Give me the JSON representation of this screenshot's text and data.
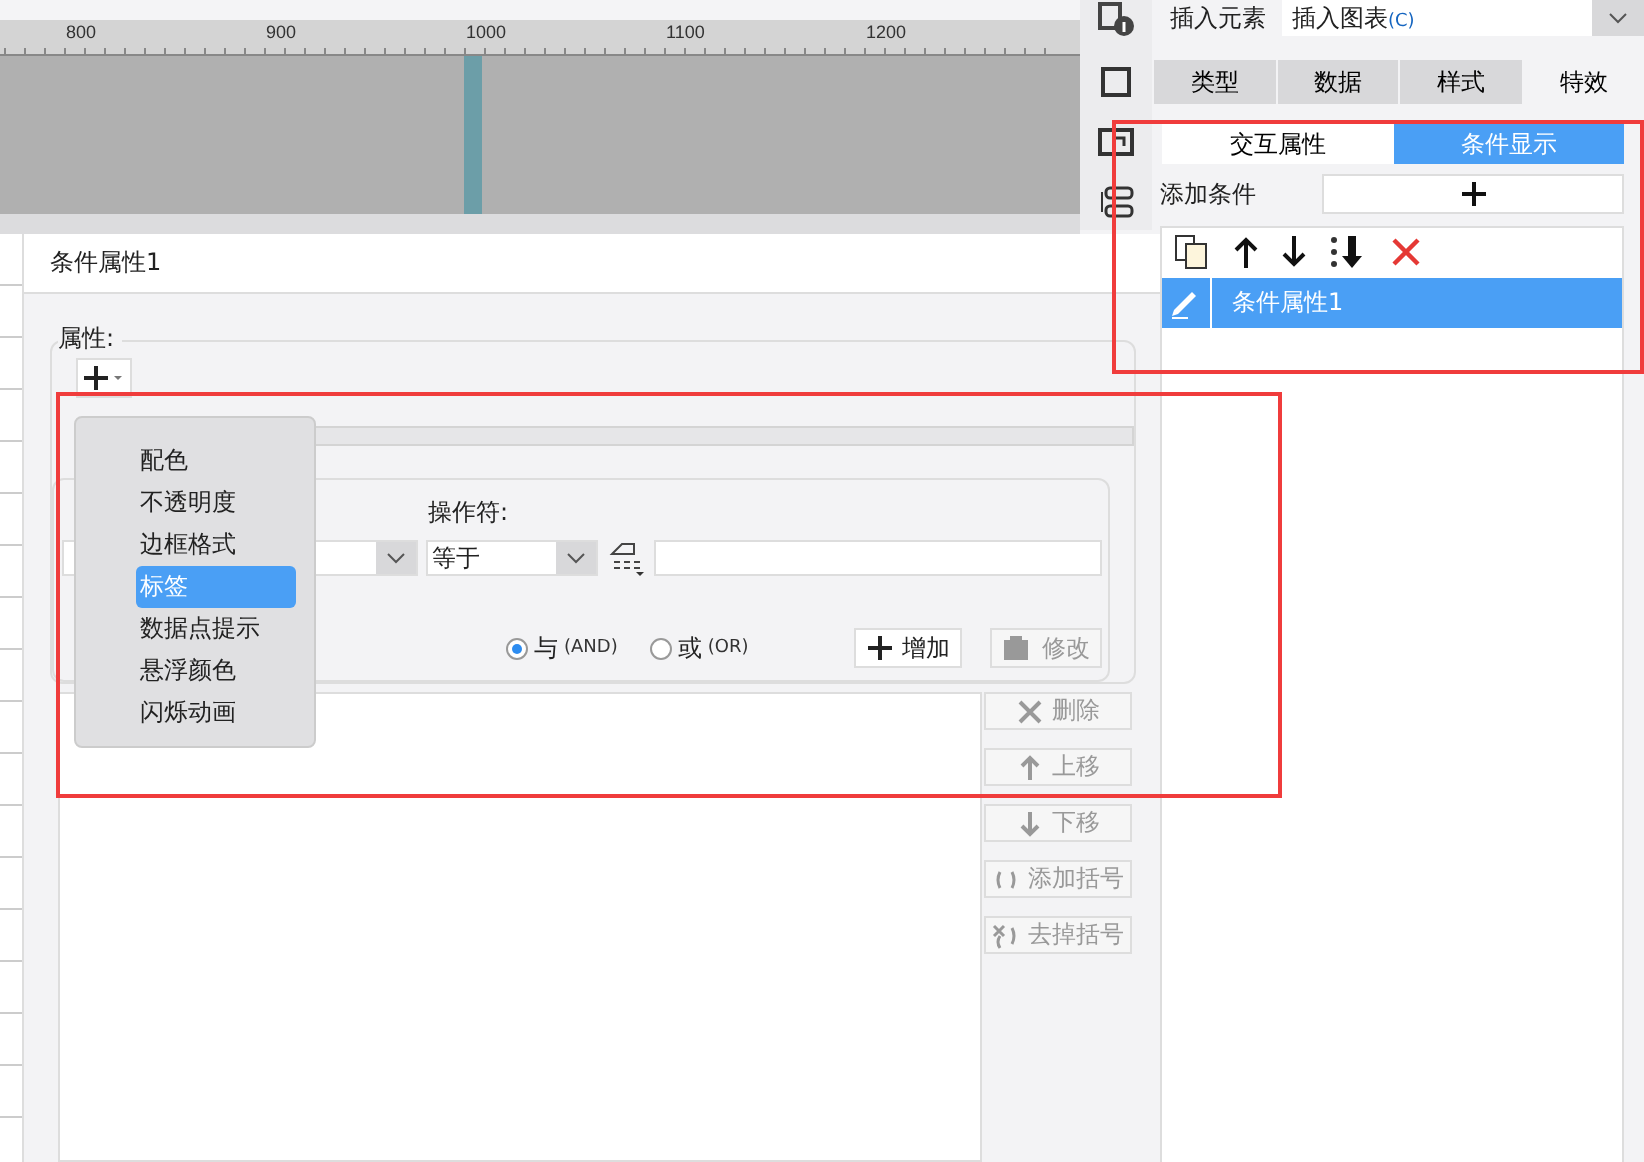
{
  "ruler": {
    "labels": [
      "800",
      "900",
      "1000",
      "1100",
      "1200"
    ]
  },
  "insert": {
    "label": "插入元素",
    "value": "插入图表",
    "shortcut": "(C)"
  },
  "tabs": [
    {
      "label": "类型",
      "selected": false
    },
    {
      "label": "数据",
      "selected": false
    },
    {
      "label": "样式",
      "selected": false
    },
    {
      "label": "特效",
      "selected": true
    }
  ],
  "subtabs": [
    {
      "label": "交互属性",
      "selected": false
    },
    {
      "label": "条件显示",
      "selected": true
    }
  ],
  "add_condition": {
    "label": "添加条件"
  },
  "conditions": [
    {
      "label": "条件属性1",
      "selected": true
    }
  ],
  "dialog": {
    "title": "条件属性1",
    "property_label": "属性:",
    "menu": [
      {
        "label": "配色",
        "selected": false
      },
      {
        "label": "不透明度",
        "selected": false
      },
      {
        "label": "边框格式",
        "selected": false
      },
      {
        "label": "标签",
        "selected": true
      },
      {
        "label": "数据点提示",
        "selected": false
      },
      {
        "label": "悬浮颜色",
        "selected": false
      },
      {
        "label": "闪烁动画",
        "selected": false
      }
    ],
    "operator_label": "操作符:",
    "operator_value": "等于",
    "logic": [
      {
        "label": "与",
        "suffix": "(AND)",
        "selected": true
      },
      {
        "label": "或",
        "suffix": "(OR)",
        "selected": false
      }
    ],
    "add_button": {
      "label": "增加",
      "disabled": false
    },
    "edit_button": {
      "label": "修改",
      "disabled": true
    },
    "side_buttons": [
      {
        "kind": "delete",
        "label": "删除",
        "disabled": true
      },
      {
        "kind": "up",
        "label": "上移",
        "disabled": true
      },
      {
        "kind": "down",
        "label": "下移",
        "disabled": true
      },
      {
        "kind": "add-paren",
        "label": "添加括号",
        "disabled": true
      },
      {
        "kind": "remove-paren",
        "label": "去掉括号",
        "disabled": true
      }
    ]
  }
}
